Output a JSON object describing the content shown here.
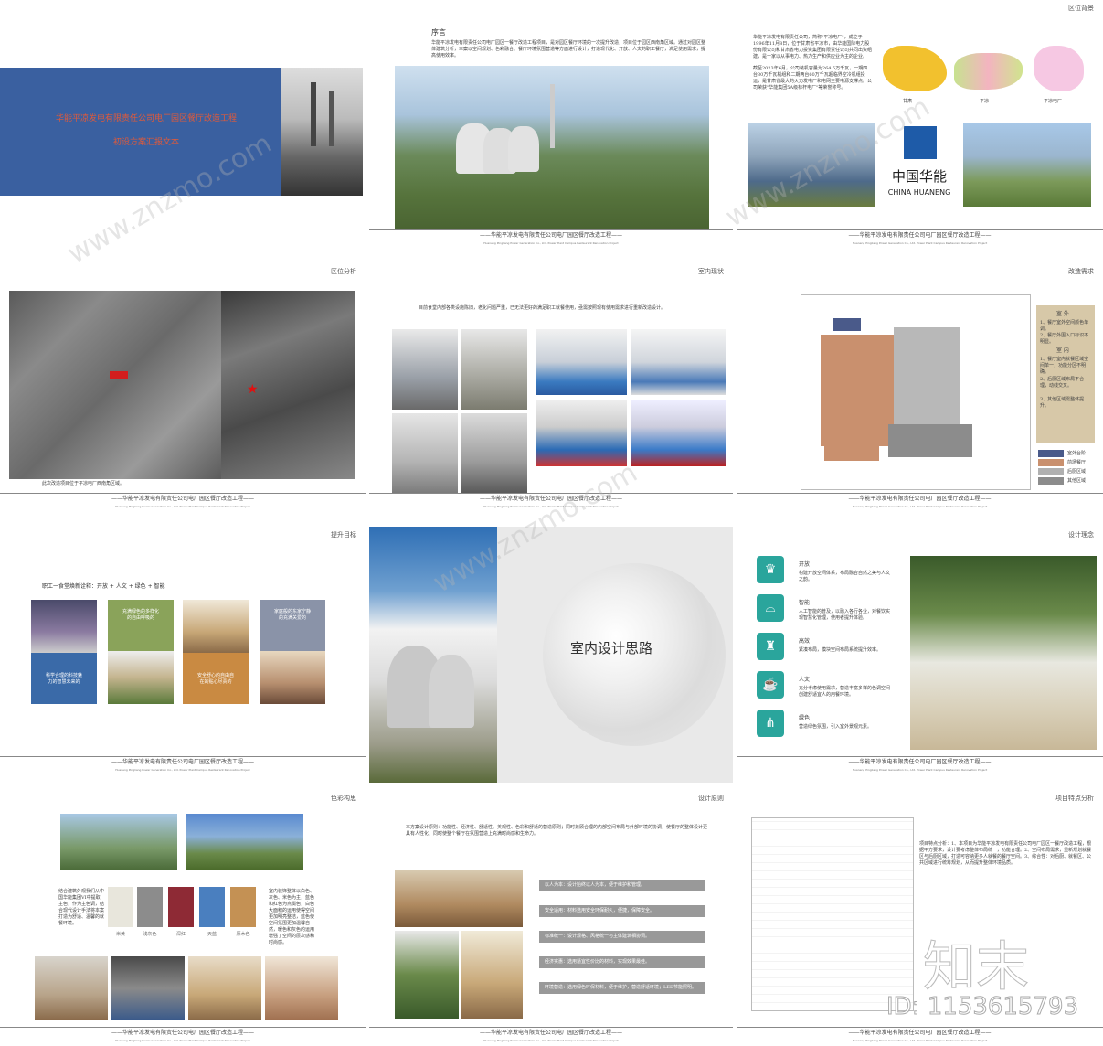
{
  "footer": {
    "title": "——华能平凉发电有限责任公司电厂园区餐厅改造工程——",
    "subtitle": "Huaneng Pingliang Power Generation Co., Ltd. Power Plant Campus Restaurant Renovation Project"
  },
  "slide1": {
    "title_line1": "华能平凉发电有限责任公司电厂园区餐厅改造工程",
    "title_line2": "初设方案汇报文本"
  },
  "slide2": {
    "heading": "序言",
    "body": "华能平凉发电有限责任公司电厂园区一餐厅改造工程项目，是对园区餐厅环境的一次提升改造，项目位于园区西南角区域。通过对园区整体建筑分析，本案以空间规划、色彩融合、餐厅环境氛围营造等方面进行设计，打造现代化、开放、人文的职工餐厅，满足使用需求，提高使用效率。"
  },
  "slide3": {
    "tag": "区位背景",
    "body1": "华能平凉发电有限责任公司，简称\"平凉电厂\"，成立于1996年11月8日，位于甘肃省平凉市，由华能国际电力股份有限公司和甘肃省电力投资集团有限责任公司共同出资组建，是一家以从事电力、热力生产和供应业为主的企业。",
    "body2": "截至2023年6月，公司装机容量为264.5万千瓦，一期四台30万千瓦机组和二期两台60万千瓦超临界空冷机组投运，是甘肃省最大的火力发电厂和电网主要电源支撑点。公司荣获\"华能集团5A级标杆电厂\"等荣誉称号。",
    "map_labels": [
      "甘肃",
      "平凉",
      "平凉电厂"
    ],
    "logo_cn": "中国华能",
    "logo_en": "CHINA HUANENG"
  },
  "slide4": {
    "tag": "区位分析",
    "caption": "此次改造项目位于平凉电厂西南角区域。"
  },
  "slide5": {
    "tag": "室内现状",
    "body": "目前食堂内部各类设施陈旧，老化问题严重，已无法更好的满足职工就餐使用，亟需按照现有使用需求进行重新改造设计。"
  },
  "slide6": {
    "tag": "改造需求",
    "notes_title_out": "室 外",
    "notes_out": [
      "1、餐厅室外空间颜色单调。",
      "2、餐厅外围入口标识不明显。"
    ],
    "notes_title_in": "室 内",
    "notes_in": [
      "1、餐厅室内就餐区域空间单一，功能分区不明确。",
      "2、后厨区域布局不合理，动线交叉。",
      "3、其他区域需整体提升。"
    ],
    "legend": [
      "室外台阶",
      "前场餐厅",
      "后厨区域",
      "其他区域"
    ],
    "legend_colors": [
      "#4a5a8a",
      "#c9906e",
      "#b0b0b0",
      "#8c8c8c"
    ]
  },
  "slide7": {
    "tag": "提升目标",
    "headline": "职工一食堂焕新诠释：开放 + 人文 + 绿色 + 智能",
    "cards": [
      "科学合理的科技魅力的智慧未来的",
      "充满绿色的多样化的自由呼吸的",
      "安全舒心的自由自在的贴心尽责的",
      "家庭般的东家宁静的充满关爱的"
    ],
    "card_colors": [
      "#3a6aa8",
      "#8aa35a",
      "#c98a42",
      "#8a93a8"
    ]
  },
  "slide8": {
    "title": "室内设计思路"
  },
  "slide9": {
    "tag": "设计理念",
    "items": [
      {
        "title": "开放",
        "desc": "构建开放空间体系，布局融合自然之美与人文之韵。"
      },
      {
        "title": "智能",
        "desc": "人工智能的普及，以融入各行各业，对餐饮实现智慧化管理，使用者提升体验。"
      },
      {
        "title": "高效",
        "desc": "紧凑布局，模块空间布局系统提升效率。"
      },
      {
        "title": "人文",
        "desc": "充分考虑使用需求，营造丰富多样的色调空间创建舒适宜人的用餐环境。"
      },
      {
        "title": "绿色",
        "desc": "营造绿色氛围，引入室外景观元素。"
      }
    ],
    "icons": [
      "chef-hat-icon",
      "cloche-icon",
      "wine-bottle-icon",
      "coffee-cup-icon",
      "cutlery-icon"
    ]
  },
  "slide10": {
    "tag": "色彩构思",
    "left_text": "结合建筑外观我们从中国华能集团VI中提取主色，作为主色调，结合现代设计手法将本案打造为舒适、温馨的就餐环境。",
    "right_text": "室内装饰整体以白色、灰色、米色为主，蓝色和红色为点缀色，白色大面积的运用使得空间更加明亮整洁，蓝色使空间氛围更加温馨自然，暖色和灰色的运用增强了空间的层次感和时尚感。",
    "swatches": [
      "米黄",
      "浅灰色",
      "深红",
      "天蓝",
      "原木色"
    ],
    "swatch_colors": [
      "#e8e6dc",
      "#8c8c8c",
      "#8e2a35",
      "#4a7fbf",
      "#c49154"
    ]
  },
  "slide11": {
    "tag": "设计原则",
    "intro": "本方案设计原则：功能性、经济性、舒适性、美观性、色彩和舒适的营造原则；同时兼顾合理的内部空间布局与外部环境的协调，使餐厅的整体设计更具有人性化，同时使整个餐厅在氛围营造上充满时尚感和生命力。",
    "bars": [
      "以人为本：设计始终以人为本，便于维护和管理。",
      "安全适用：材料选用安全环保耐久，便捷，保障安全。",
      "标准统一：设计规格、风格统一与主体建筑相协调。",
      "经济实惠：选用适宜性价比的材料，实现效果最佳。",
      "环境营造：选用绿色环保材料，便于维护，营造舒适环境；LED节能照明。"
    ]
  },
  "slide12": {
    "tag": "项目特点分析",
    "body": "项目特点分析：1、本项目为华能平凉发电有限责任公司电厂园区一餐厅改造工程，根据甲方要求，设计要考虑整体布局统一，功能合理。2、空间布局需求，重新规划就餐区与后厨区域，打造可容纳更多人就餐的餐厅空间。3、综合性：对后厨、就餐区、公共区域进行统筹规划，从而提升整体环境品质。"
  },
  "watermark": {
    "site": "www.znzmo.com",
    "brand": "知末",
    "id": "ID: 1153615793"
  }
}
